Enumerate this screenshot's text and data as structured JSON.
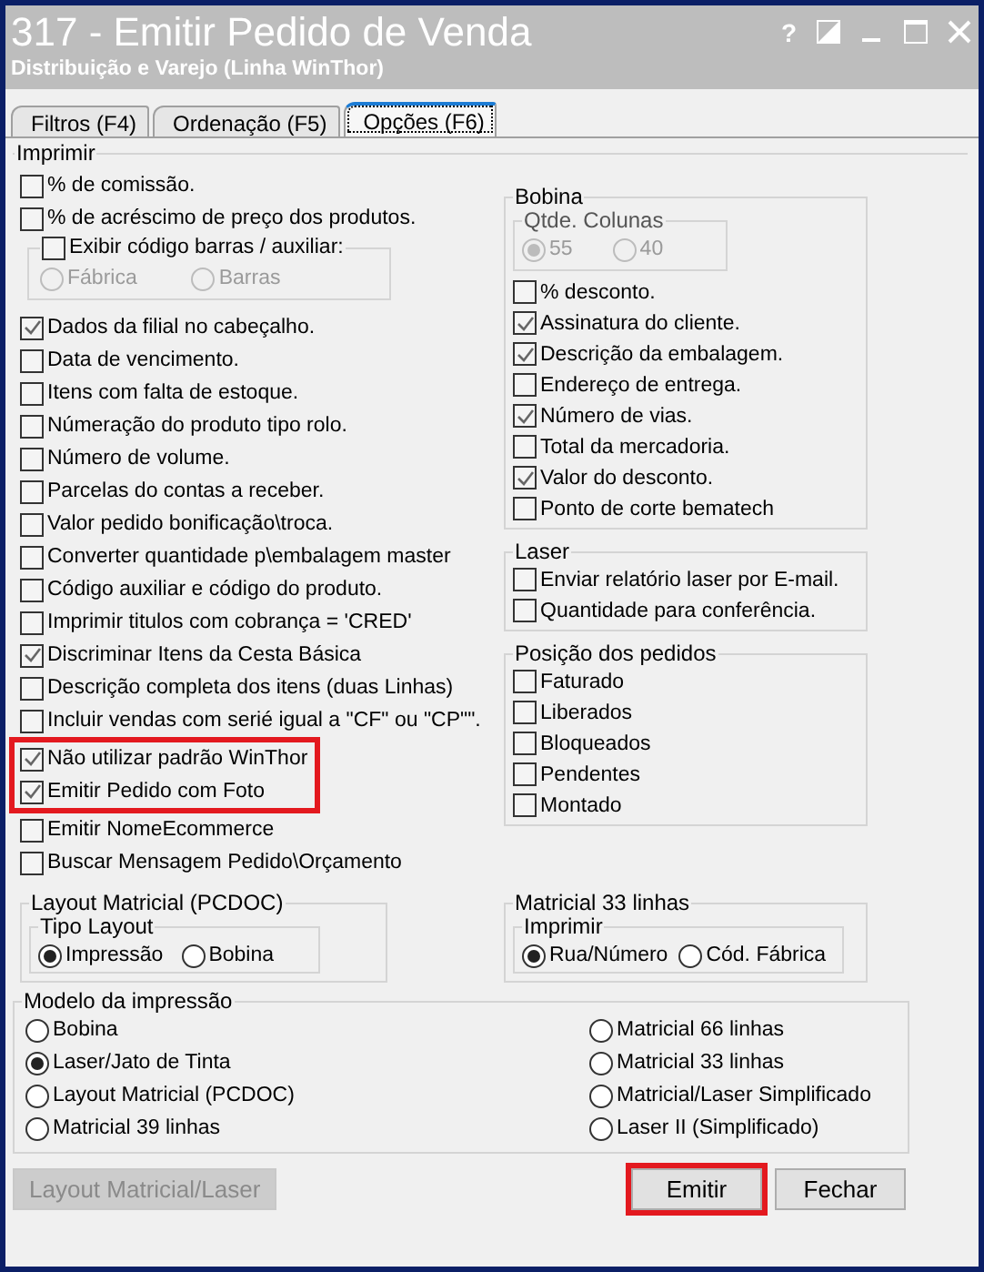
{
  "window": {
    "title": "317 - Emitir Pedido de Venda",
    "subtitle": "Distribuição e Varejo (Linha WinThor)",
    "help_glyph": "?"
  },
  "tabs": [
    {
      "label": "Filtros (F4)",
      "selected": false
    },
    {
      "label": "Ordenação (F5)",
      "selected": false
    },
    {
      "label": "Opções (F6)",
      "selected": true
    }
  ],
  "imprimir": {
    "title": "Imprimir",
    "left_items": [
      {
        "kind": "checkbox",
        "label": "% de comissão.",
        "checked": false,
        "highlighted": false
      },
      {
        "kind": "checkbox",
        "label": "% de acréscimo de preço dos produtos.",
        "checked": false,
        "highlighted": false
      },
      {
        "kind": "subgroup",
        "label": "Exibir código barras / auxiliar:",
        "checked": false,
        "disabled": true,
        "options": [
          {
            "label": "Fábrica",
            "selected": false
          },
          {
            "label": "Barras",
            "selected": false
          }
        ]
      },
      {
        "kind": "checkbox",
        "label": "Dados da filial no cabeçalho.",
        "checked": true,
        "highlighted": false
      },
      {
        "kind": "checkbox",
        "label": "Data de vencimento.",
        "checked": false,
        "highlighted": false
      },
      {
        "kind": "checkbox",
        "label": "Itens com falta de estoque.",
        "checked": false,
        "highlighted": false
      },
      {
        "kind": "checkbox",
        "label": "Númeração do produto tipo rolo.",
        "checked": false,
        "highlighted": false
      },
      {
        "kind": "checkbox",
        "label": "Número de volume.",
        "checked": false,
        "highlighted": false
      },
      {
        "kind": "checkbox",
        "label": "Parcelas do contas a receber.",
        "checked": false,
        "highlighted": false
      },
      {
        "kind": "checkbox",
        "label": "Valor pedido bonificação\\troca.",
        "checked": false,
        "highlighted": false
      },
      {
        "kind": "checkbox",
        "label": "Converter quantidade p\\embalagem master",
        "checked": false,
        "highlighted": false
      },
      {
        "kind": "checkbox",
        "label": "Código auxiliar e código do produto.",
        "checked": false,
        "highlighted": false
      },
      {
        "kind": "checkbox",
        "label": "Imprimir titulos com cobrança = 'CRED'",
        "checked": false,
        "highlighted": false
      },
      {
        "kind": "checkbox",
        "label": "Discriminar Itens da Cesta Básica",
        "checked": true,
        "highlighted": false
      },
      {
        "kind": "checkbox",
        "label": "Descrição completa dos itens (duas Linhas)",
        "checked": false,
        "highlighted": false
      },
      {
        "kind": "checkbox",
        "label": "Incluir vendas com serié igual a \"CF\" ou \"CP\"\".",
        "checked": false,
        "highlighted": false
      },
      {
        "kind": "checkbox",
        "label": "Não utilizar padrão WinThor",
        "checked": true,
        "highlighted": true
      },
      {
        "kind": "checkbox",
        "label": "Emitir Pedido com Foto",
        "checked": true,
        "highlighted": true
      },
      {
        "kind": "checkbox",
        "label": "Emitir NomeEcommerce",
        "checked": false,
        "highlighted": false
      },
      {
        "kind": "checkbox",
        "label": "Buscar Mensagem Pedido\\Orçamento",
        "checked": false,
        "highlighted": false
      }
    ],
    "layout_matricial": {
      "title": "Layout Matricial (PCDOC)",
      "subtitle": "Tipo Layout",
      "options": [
        {
          "label": "Impressão",
          "selected": true
        },
        {
          "label": "Bobina",
          "selected": false
        }
      ]
    },
    "bobina": {
      "title": "Bobina",
      "colunas": {
        "title": "Qtde. Colunas",
        "disabled": true,
        "options": [
          {
            "label": "55",
            "selected": true
          },
          {
            "label": "40",
            "selected": false
          }
        ]
      },
      "items": [
        {
          "label": "% desconto.",
          "checked": false
        },
        {
          "label": "Assinatura do cliente.",
          "checked": true
        },
        {
          "label": "Descrição da embalagem.",
          "checked": true
        },
        {
          "label": "Endereço de entrega.",
          "checked": false
        },
        {
          "label": "Número de vias.",
          "checked": true
        },
        {
          "label": "Total da mercadoria.",
          "checked": false
        },
        {
          "label": "Valor do desconto.",
          "checked": true
        },
        {
          "label": "Ponto de corte bematech",
          "checked": false
        }
      ]
    },
    "laser": {
      "title": "Laser",
      "items": [
        {
          "label": "Enviar relatório laser por E-mail.",
          "checked": false
        },
        {
          "label": "Quantidade para conferência.",
          "checked": false
        }
      ]
    },
    "posicao": {
      "title": "Posição dos pedidos",
      "items": [
        {
          "label": "Faturado",
          "checked": false
        },
        {
          "label": "Liberados",
          "checked": false
        },
        {
          "label": "Bloqueados",
          "checked": false
        },
        {
          "label": "Pendentes",
          "checked": false
        },
        {
          "label": "Montado",
          "checked": false
        }
      ]
    },
    "matricial33": {
      "title": "Matricial 33 linhas",
      "subtitle": "Imprimir",
      "options": [
        {
          "label": "Rua/Número",
          "selected": true
        },
        {
          "label": "Cód. Fábrica",
          "selected": false
        }
      ]
    }
  },
  "modelo": {
    "title": "Modelo da impressão",
    "columns": [
      [
        {
          "label": "Bobina",
          "selected": false
        },
        {
          "label": "Laser/Jato de Tinta",
          "selected": true
        },
        {
          "label": "Layout Matricial (PCDOC)",
          "selected": false
        },
        {
          "label": "Matricial 39 linhas",
          "selected": false
        }
      ],
      [
        {
          "label": "Matricial 66 linhas",
          "selected": false
        },
        {
          "label": "Matricial 33 linhas",
          "selected": false
        },
        {
          "label": "Matricial/Laser Simplificado",
          "selected": false
        },
        {
          "label": "Laser II (Simplificado)",
          "selected": false
        }
      ]
    ]
  },
  "buttons": [
    {
      "label": "Layout Matricial/Laser",
      "disabled": true,
      "highlighted": false
    },
    {
      "label": "Emitir",
      "disabled": false,
      "highlighted": true
    },
    {
      "label": "Fechar",
      "disabled": false,
      "highlighted": false
    }
  ]
}
